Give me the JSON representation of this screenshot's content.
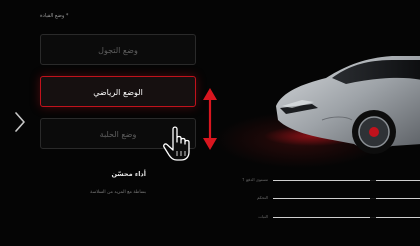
{
  "header": {
    "label": "* وضع القيادة"
  },
  "modes": [
    {
      "label": "وضع التجول",
      "state": "inactive"
    },
    {
      "label": "الوضع الرياضي",
      "state": "selected"
    },
    {
      "label": "وضع الحلبة",
      "state": "inactive"
    }
  ],
  "performance": {
    "title": "أداء محسّن",
    "subtitle": "بساطة مع المزيد من السلاسة"
  },
  "stats": [
    {
      "label": "مستوى الدفع ↑"
    },
    {
      "label": "التحكم"
    },
    {
      "label": "الثبات"
    }
  ],
  "colors": {
    "accent": "#d9161f",
    "background": "#050505",
    "selected_border": "#c1121c"
  },
  "icons": {
    "nav": "chevron-right-icon",
    "drag": "vertical-double-arrow-icon",
    "pointer": "hand-pointer-icon"
  }
}
